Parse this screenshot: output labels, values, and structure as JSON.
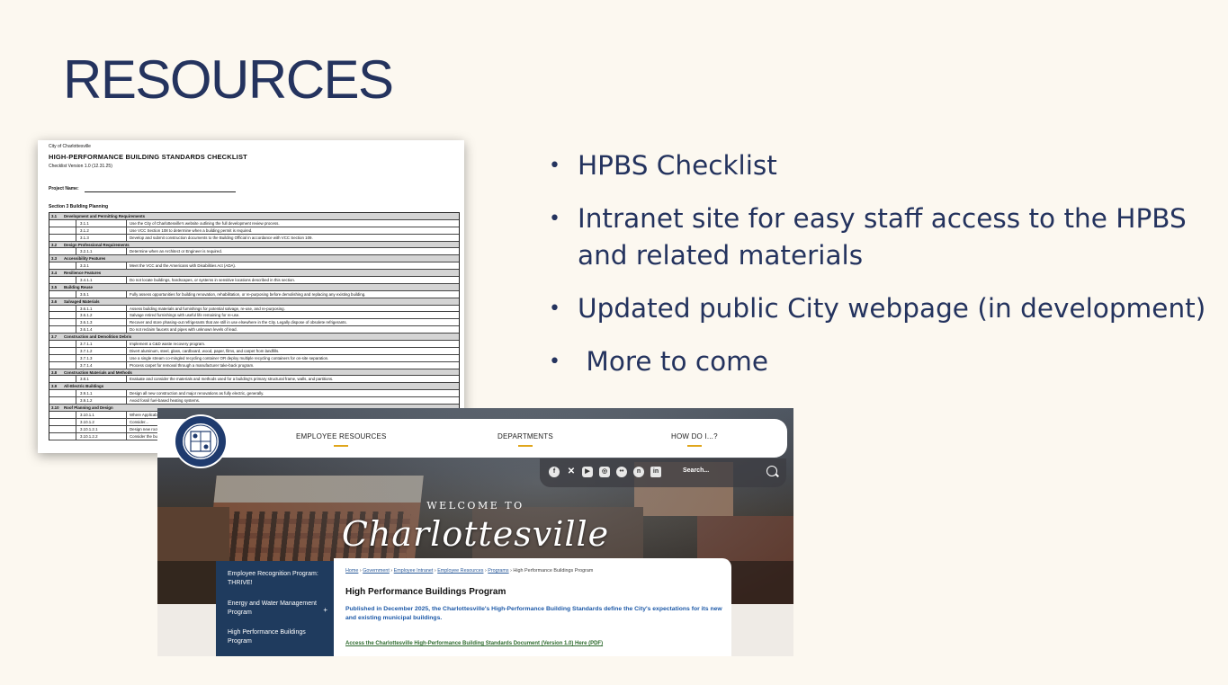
{
  "slide": {
    "title": "RESOURCES",
    "bullets": [
      "HPBS Checklist",
      "Intranet site for easy staff access to the HPBS and related materials",
      "Updated public City webpage (in development)",
      " More to come"
    ]
  },
  "checklist": {
    "city": "City of Charlottesville",
    "title": "HIGH-PERFORMANCE BUILDING STANDARDS CHECKLIST",
    "version": "Checklist Version 1.0 (12.31.25)",
    "project_label": "Project Name:",
    "section": "Section 3 Building Planning",
    "rows": [
      {
        "kind": "hdr",
        "num": "3.1",
        "text": "Development and Permitting Requirements"
      },
      {
        "kind": "item",
        "num": "3.1.1",
        "text": "Use the City of Charlottesville's website outlining the full development review process."
      },
      {
        "kind": "item",
        "num": "3.1.2",
        "text": "Use VCC Section 108 to determine when a building permit is required."
      },
      {
        "kind": "item",
        "num": "3.1.3",
        "text": "Develop and submit construction documents to the Building Official in accordance with VCC Section 109."
      },
      {
        "kind": "hdr",
        "num": "3.2",
        "text": "Design Professional Requirements"
      },
      {
        "kind": "item",
        "num": "3.2.1.1",
        "text": "Determine when an Architect or Engineer is required."
      },
      {
        "kind": "hdr",
        "num": "3.3",
        "text": "Accessibility Features"
      },
      {
        "kind": "item",
        "num": "3.3.1",
        "text": "Meet the VCC and the Americans with Disabilities Act (ADA)."
      },
      {
        "kind": "hdr",
        "num": "3.4",
        "text": "Resilience Features"
      },
      {
        "kind": "item",
        "num": "3.4.1.1",
        "text": "Do not locate buildings, hardscapes, or systems in sensitive locations described in this section."
      },
      {
        "kind": "hdr",
        "num": "3.5",
        "text": "Building Reuse"
      },
      {
        "kind": "item",
        "num": "3.5.1",
        "text": "Fully assess opportunities for building renovation, rehabilitation, or re-purposing before demolishing and replacing any existing building."
      },
      {
        "kind": "hdr",
        "num": "3.6",
        "text": "Salvaged Materials"
      },
      {
        "kind": "item",
        "num": "3.6.1.1",
        "text": "Assess building materials and furnishings for potential salvage, re-use, and re-purposing."
      },
      {
        "kind": "item",
        "num": "3.6.1.2",
        "text": "Salvage retired furnishings with useful life remaining for re-use."
      },
      {
        "kind": "item",
        "num": "3.6.1.3",
        "text": "Recover and store phasing-out refrigerants that are still in use elsewhere in the City. Legally dispose of obsolete refrigerants."
      },
      {
        "kind": "item",
        "num": "3.6.1.4",
        "text": "Do not reclaim faucets and pipes with unknown levels of lead."
      },
      {
        "kind": "hdr",
        "num": "3.7",
        "text": "Construction and Demolition Debris"
      },
      {
        "kind": "item",
        "num": "3.7.1.1",
        "text": "Implement a C&D waste recovery program."
      },
      {
        "kind": "item",
        "num": "3.7.1.2",
        "text": "Divert aluminum, steel, glass, cardboard, wood, paper, films, and carpet from landfills."
      },
      {
        "kind": "item",
        "num": "3.7.1.3",
        "text": "Use a single stream co-mingled recycling container OR deploy multiple recycling containers for on-site separation."
      },
      {
        "kind": "item",
        "num": "3.7.1.4",
        "text": "Process carpet for removal through a manufacturer take-back program."
      },
      {
        "kind": "hdr",
        "num": "3.8",
        "text": "Construction Materials and Methods"
      },
      {
        "kind": "item",
        "num": "3.8.1",
        "text": "Evaluate and consider the materials and methods used for a building's primary structural frame, walls, and partitions."
      },
      {
        "kind": "hdr",
        "num": "3.9",
        "text": "All-Electric Buildings"
      },
      {
        "kind": "item",
        "num": "3.9.1.1",
        "text": "Design all new construction and major renovations as fully electric, generally."
      },
      {
        "kind": "item",
        "num": "3.9.1.2",
        "text": "Avoid fossil fuel-based heating systems."
      },
      {
        "kind": "hdr",
        "num": "3.10",
        "text": "Roof Planning and Design"
      },
      {
        "kind": "item",
        "num": "3.10.1.1",
        "text": "Where Applicable"
      },
      {
        "kind": "item",
        "num": "3.10.1.2",
        "text": "Consider..."
      },
      {
        "kind": "item",
        "num": "3.10.1.2.1",
        "text": "Design new roofs shall be..."
      },
      {
        "kind": "item",
        "num": "3.10.1.2.2",
        "text": "Consider the building's roof..."
      }
    ]
  },
  "website": {
    "nav": [
      "EMPLOYEE RESOURCES",
      "DEPARTMENTS",
      "HOW DO I...?"
    ],
    "social_icons": [
      "facebook-icon",
      "x-icon",
      "youtube-icon",
      "instagram-icon",
      "flickr-icon",
      "nextdoor-icon",
      "linkedin-icon"
    ],
    "search_placeholder": "Search...",
    "welcome": "WELCOME TO",
    "city_script": "Charlottesville",
    "sidenav": [
      "Employee Recognition Program: THRIVE!",
      "Energy and Water Management Program",
      "High Performance Buildings Program"
    ],
    "breadcrumbs": [
      "Home",
      "Government",
      "Employee Intranet",
      "Employee Resources",
      "Programs",
      "High Performance Buildings Program"
    ],
    "page_title": "High Performance Buildings Program",
    "intro": "Published in December 2025, the Charlottesville's High-Performance Building Standards define the City's expectations for its new and existing municipal buildings.",
    "doc_link": "Access the Charlottesville High-Performance Building Standards Document (Version 1.0) Here (PDF)"
  },
  "colors": {
    "title_navy": "#24335e",
    "accent_gold": "#e0a61c",
    "sidenav_blue": "#1f3b5e",
    "background": "#fcf8f0"
  }
}
